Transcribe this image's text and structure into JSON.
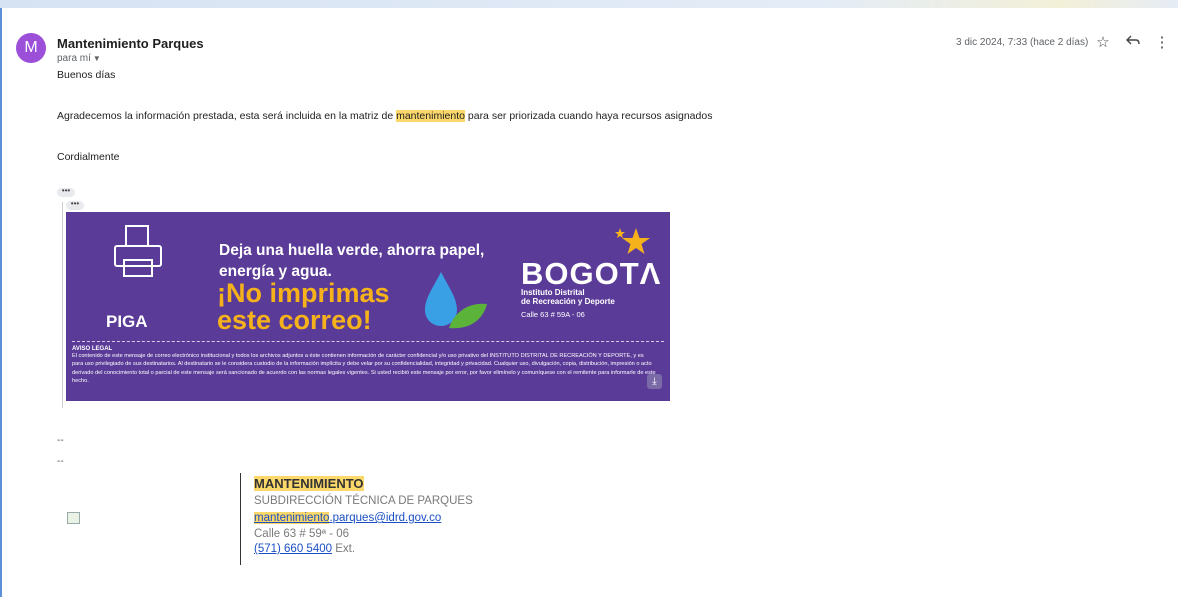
{
  "email": {
    "sender_initial": "M",
    "sender_name": "Mantenimiento Parques",
    "to_label": "para mí",
    "date": "3 dic 2024, 7:33 (hace 2 días)",
    "greeting": "Buenos días",
    "body_before": "Agradecemos la información prestada, esta será incluida en la matriz de ",
    "body_highlight": "mantenimiento",
    "body_after": " para ser priorizada cuando haya recursos asignados",
    "closing": "Cordialmente",
    "ellipsis": "•••"
  },
  "banner": {
    "title_line1": "Deja una huella verde, ahorra papel,",
    "title_line2": "energía y agua.",
    "big_line1": "¡No imprimas",
    "big_line2": "este correo!",
    "brand": "BOGOTΛ",
    "institute_line1": "Instituto Distrital",
    "institute_line2": "de Recreación y Deporte",
    "address": "Calle 63 # 59A - 06",
    "pica_logo": "PIGA",
    "aviso_title": "AVISO LEGAL",
    "aviso_text": "El contenido de este mensaje de correo electrónico institucional y todos los archivos adjuntos a éste contienen información de carácter confidencial y/o uso privativo del INSTITUTO DISTRITAL DE RECREACIÓN Y DEPORTE, y es para uso privilegiado de sus destinatarios. Al destinatario se le considera custodio de la información implícita y debe velar por su confidencialidad, integridad y privacidad. Cualquier uso, divulgación, copia, distribución, impresión o acto derivado del conocimiento total o parcial de este mensaje será sancionado de acuerdo con las normas legales vigentes. Si usted recibió este mensaje por error, por favor elimínelo y comuníquese con el remitente para informarle de este hecho.",
    "colors": {
      "background": "#5b3b98",
      "accent": "#f6b21a"
    }
  },
  "signature": {
    "separator1": "--",
    "separator2": "--",
    "title": "MANTENIMIENTO",
    "subtitle": "SUBDIRECCIÓN TÉCNICA DE PARQUES",
    "email_highlight": "mantenimiento",
    "email_rest": ".parques@idrd.gov.co",
    "address": "Calle 63 # 59ª - 06",
    "phone": "(571) 660 5400",
    "ext": " Ext."
  },
  "icons": [
    "star-icon",
    "reply-icon",
    "more-vert-icon",
    "download-icon",
    "printer-icon",
    "water-drop-icon",
    "leaf-icon",
    "star-logo-icon"
  ]
}
